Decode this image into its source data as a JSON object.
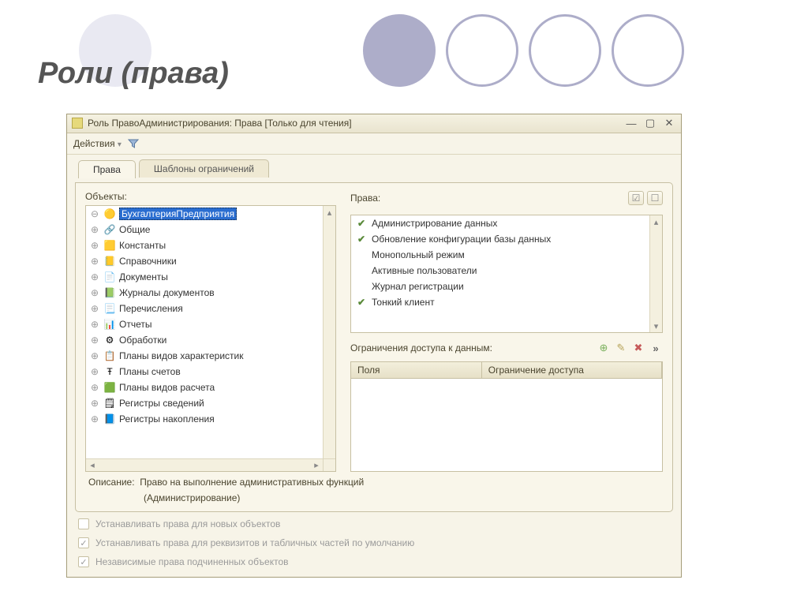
{
  "slide": {
    "title": "Роли (права)"
  },
  "window": {
    "title": "Роль ПравоАдминистрирования: Права [Только для чтения]"
  },
  "toolbar": {
    "actions_label": "Действия"
  },
  "tabs": {
    "tab1": "Права",
    "tab2": "Шаблоны ограничений"
  },
  "objects": {
    "label": "Объекты:",
    "root": "БухгалтерияПредприятия",
    "items": [
      "Общие",
      "Константы",
      "Справочники",
      "Документы",
      "Журналы документов",
      "Перечисления",
      "Отчеты",
      "Обработки",
      "Планы видов характеристик",
      "Планы счетов",
      "Планы видов расчета",
      "Регистры сведений",
      "Регистры накопления"
    ],
    "icons": [
      "🔗",
      "🟨",
      "📒",
      "📄",
      "📗",
      "📃",
      "📊",
      "⚙",
      "📋",
      "Ŧ",
      "🟩",
      "🗒",
      "📘"
    ]
  },
  "rights": {
    "label": "Права:",
    "items": [
      {
        "checked": true,
        "label": "Администрирование данных"
      },
      {
        "checked": true,
        "label": "Обновление конфигурации базы данных"
      },
      {
        "checked": false,
        "label": "Монопольный режим"
      },
      {
        "checked": false,
        "label": "Активные пользователи"
      },
      {
        "checked": false,
        "label": "Журнал регистрации"
      },
      {
        "checked": true,
        "label": "Тонкий клиент"
      }
    ]
  },
  "restrictions": {
    "label": "Ограничения доступа к данным:",
    "col1": "Поля",
    "col2": "Ограничение доступа"
  },
  "description": {
    "label": "Описание:",
    "line1": "Право на выполнение административных функций",
    "line2": "(Администрирование)"
  },
  "options": {
    "opt1": "Устанавливать права для новых объектов",
    "opt2": "Устанавливать права для реквизитов и табличных частей по умолчанию",
    "opt3": "Независимые права подчиненных объектов"
  }
}
